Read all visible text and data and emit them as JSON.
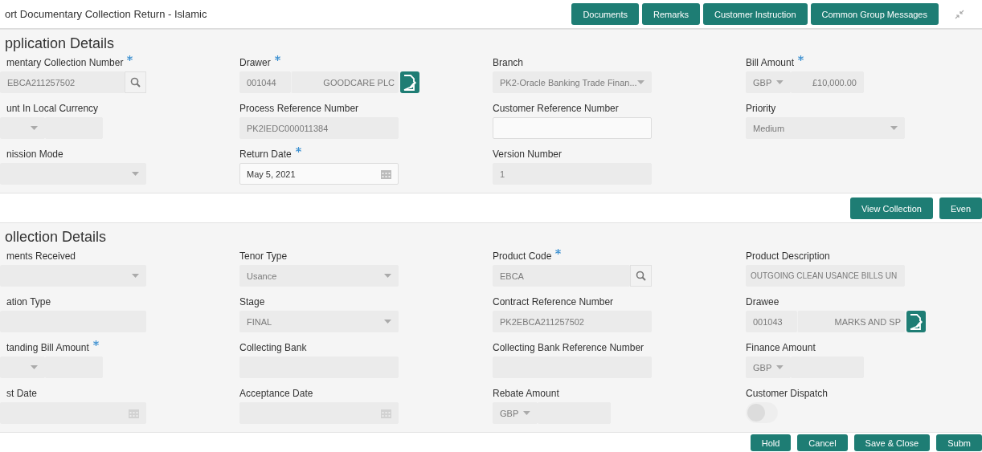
{
  "header": {
    "title": "ort Documentary Collection Return - Islamic",
    "buttons": [
      "Documents",
      "Remarks",
      "Customer Instruction",
      "Common Group Messages"
    ]
  },
  "sections": [
    {
      "title": "pplication Details",
      "fields": [
        {
          "label": "mentary Collection Number",
          "required": true,
          "kind": "search",
          "value": "EBCA211257502",
          "disabled": true
        },
        {
          "label": "Drawer",
          "required": true,
          "kind": "lookup",
          "code": "001044",
          "name": "GOODCARE PLC",
          "disabled": true
        },
        {
          "label": "Branch",
          "required": false,
          "kind": "select",
          "value": "PK2-Oracle Banking Trade Finan...",
          "disabled": true
        },
        {
          "label": "Bill Amount",
          "required": true,
          "kind": "amount",
          "currency": "GBP",
          "value": "£10,000.00",
          "disabled": true
        },
        {
          "label": "unt In Local Currency",
          "required": false,
          "kind": "amount",
          "disabled": true
        },
        {
          "label": "Process Reference Number",
          "required": false,
          "kind": "text",
          "value": "PK2IEDC000011384",
          "disabled": true
        },
        {
          "label": "Customer Reference Number",
          "required": false,
          "kind": "text",
          "disabled": false
        },
        {
          "label": "Priority",
          "required": false,
          "kind": "select",
          "value": "Medium",
          "disabled": true
        },
        {
          "label": "nission Mode",
          "required": false,
          "kind": "select",
          "disabled": true
        },
        {
          "label": "Return Date",
          "required": true,
          "kind": "date",
          "value": "May 5, 2021",
          "disabled": false
        },
        {
          "label": "Version Number",
          "required": false,
          "kind": "text",
          "value": "1",
          "disabled": true
        }
      ]
    },
    {
      "title": "ollection Details",
      "buttons": [
        "View Collection",
        "Even"
      ],
      "fields": [
        {
          "label": "ments Received",
          "required": false,
          "kind": "select",
          "disabled": true
        },
        {
          "label": "Tenor Type",
          "required": false,
          "kind": "select",
          "value": "Usance",
          "disabled": true
        },
        {
          "label": "Product Code",
          "required": true,
          "kind": "search",
          "value": "EBCA",
          "disabled": true
        },
        {
          "label": "Product Description",
          "required": false,
          "kind": "text",
          "value": "OUTGOING CLEAN USANCE BILLS UN",
          "disabled": true
        },
        {
          "label": "ation Type",
          "required": false,
          "kind": "text",
          "disabled": true
        },
        {
          "label": "Stage",
          "required": false,
          "kind": "select",
          "value": "FINAL",
          "disabled": true
        },
        {
          "label": "Contract Reference Number",
          "required": false,
          "kind": "text",
          "value": "PK2EBCA211257502",
          "disabled": true
        },
        {
          "label": "Drawee",
          "required": false,
          "kind": "lookup",
          "code": "001043",
          "name": "MARKS AND SP",
          "disabled": true
        },
        {
          "label": "tanding Bill Amount",
          "required": true,
          "kind": "amount",
          "disabled": true
        },
        {
          "label": "Collecting Bank",
          "required": false,
          "kind": "text",
          "disabled": true
        },
        {
          "label": "Collecting Bank Reference Number",
          "required": false,
          "kind": "text",
          "disabled": true
        },
        {
          "label": "Finance Amount",
          "required": false,
          "kind": "amount",
          "currency": "GBP",
          "disabled": true
        },
        {
          "label": "st Date",
          "required": false,
          "kind": "date",
          "disabled": true
        },
        {
          "label": "Acceptance Date",
          "required": false,
          "kind": "date",
          "disabled": true
        },
        {
          "label": "Rebate Amount",
          "required": false,
          "kind": "amount",
          "currency": "GBP",
          "disabled": true
        },
        {
          "label": "Customer Dispatch",
          "required": false,
          "kind": "toggle",
          "checked": false,
          "disabled": true
        }
      ]
    }
  ],
  "footer": {
    "buttons": [
      "Hold",
      "Cancel",
      "Save & Close",
      "Subm"
    ]
  }
}
